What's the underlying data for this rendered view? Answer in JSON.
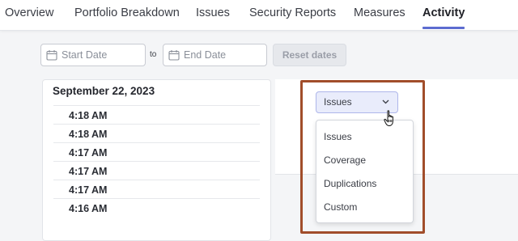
{
  "nav": {
    "tabs": [
      {
        "label": "Overview"
      },
      {
        "label": "Portfolio Breakdown"
      },
      {
        "label": "Issues"
      },
      {
        "label": "Security Reports"
      },
      {
        "label": "Measures"
      },
      {
        "label": "Activity",
        "active": true
      }
    ]
  },
  "filters": {
    "start_placeholder": "Start Date",
    "to_label": "to",
    "end_placeholder": "End Date",
    "reset_label": "Reset dates"
  },
  "activity": {
    "date": "September 22, 2023",
    "times": [
      "4:18 AM",
      "4:18 AM",
      "4:17 AM",
      "4:17 AM",
      "4:17 AM",
      "4:16 AM"
    ]
  },
  "graph_select": {
    "selected": "Issues",
    "options": [
      "Issues",
      "Coverage",
      "Duplications",
      "Custom"
    ]
  },
  "colors": {
    "active_tab_underline": "#5d6cd0",
    "highlight_border": "#a14d2a",
    "select_bg": "#e9ecfb"
  },
  "icons": [
    "calendar-icon",
    "chevron-down-icon",
    "hand-pointer-icon"
  ]
}
